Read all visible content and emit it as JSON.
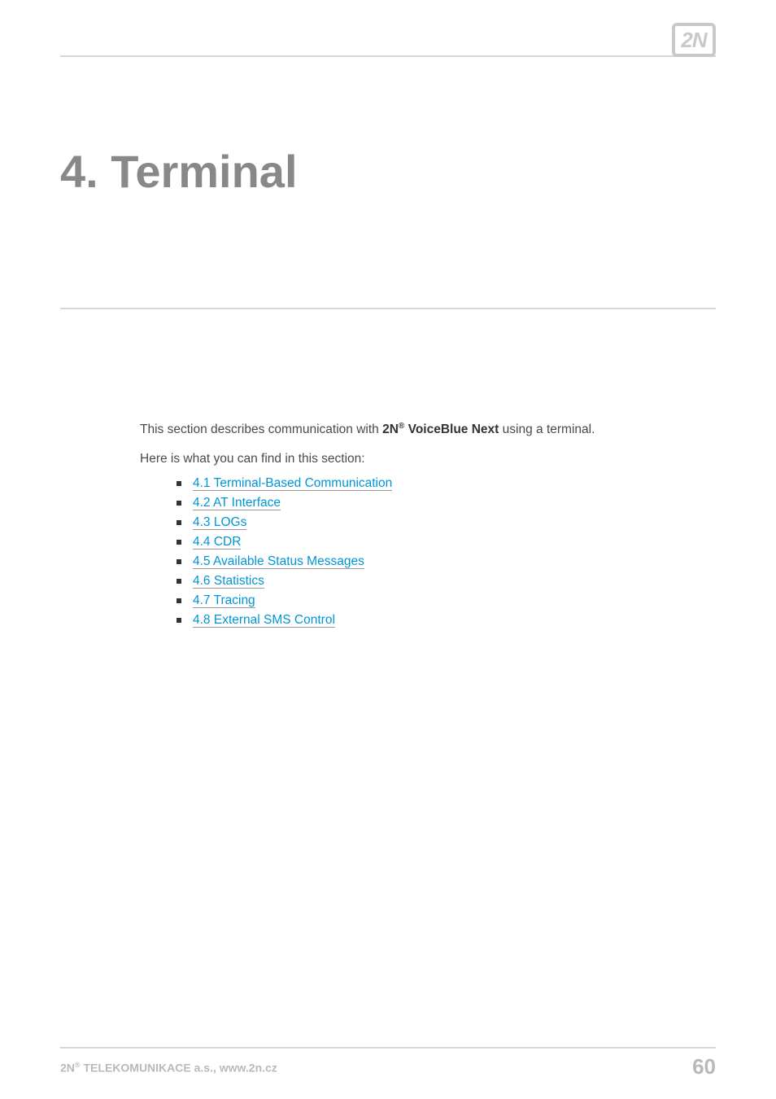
{
  "logo": "2N",
  "chapter_title": "4. Terminal",
  "intro_prefix": "This section describes communication with ",
  "intro_brand_pre": "2N",
  "intro_brand_sup": "®",
  "intro_brand_post": " VoiceBlue Next",
  "intro_suffix": " using a terminal.",
  "sub_intro": "Here is what you can find in this section:",
  "links": [
    "4.1 Terminal-Based Communication",
    "4.2 AT Interface",
    "4.3 LOGs",
    "4.4 CDR",
    "4.5 Available Status Messages",
    "4.6 Statistics",
    "4.7 Tracing",
    "4.8 External SMS Control"
  ],
  "footer_left_pre": "2N",
  "footer_left_sup": "®",
  "footer_left_post": " TELEKOMUNIKACE a.s., www.2n.cz",
  "page_number": "60"
}
